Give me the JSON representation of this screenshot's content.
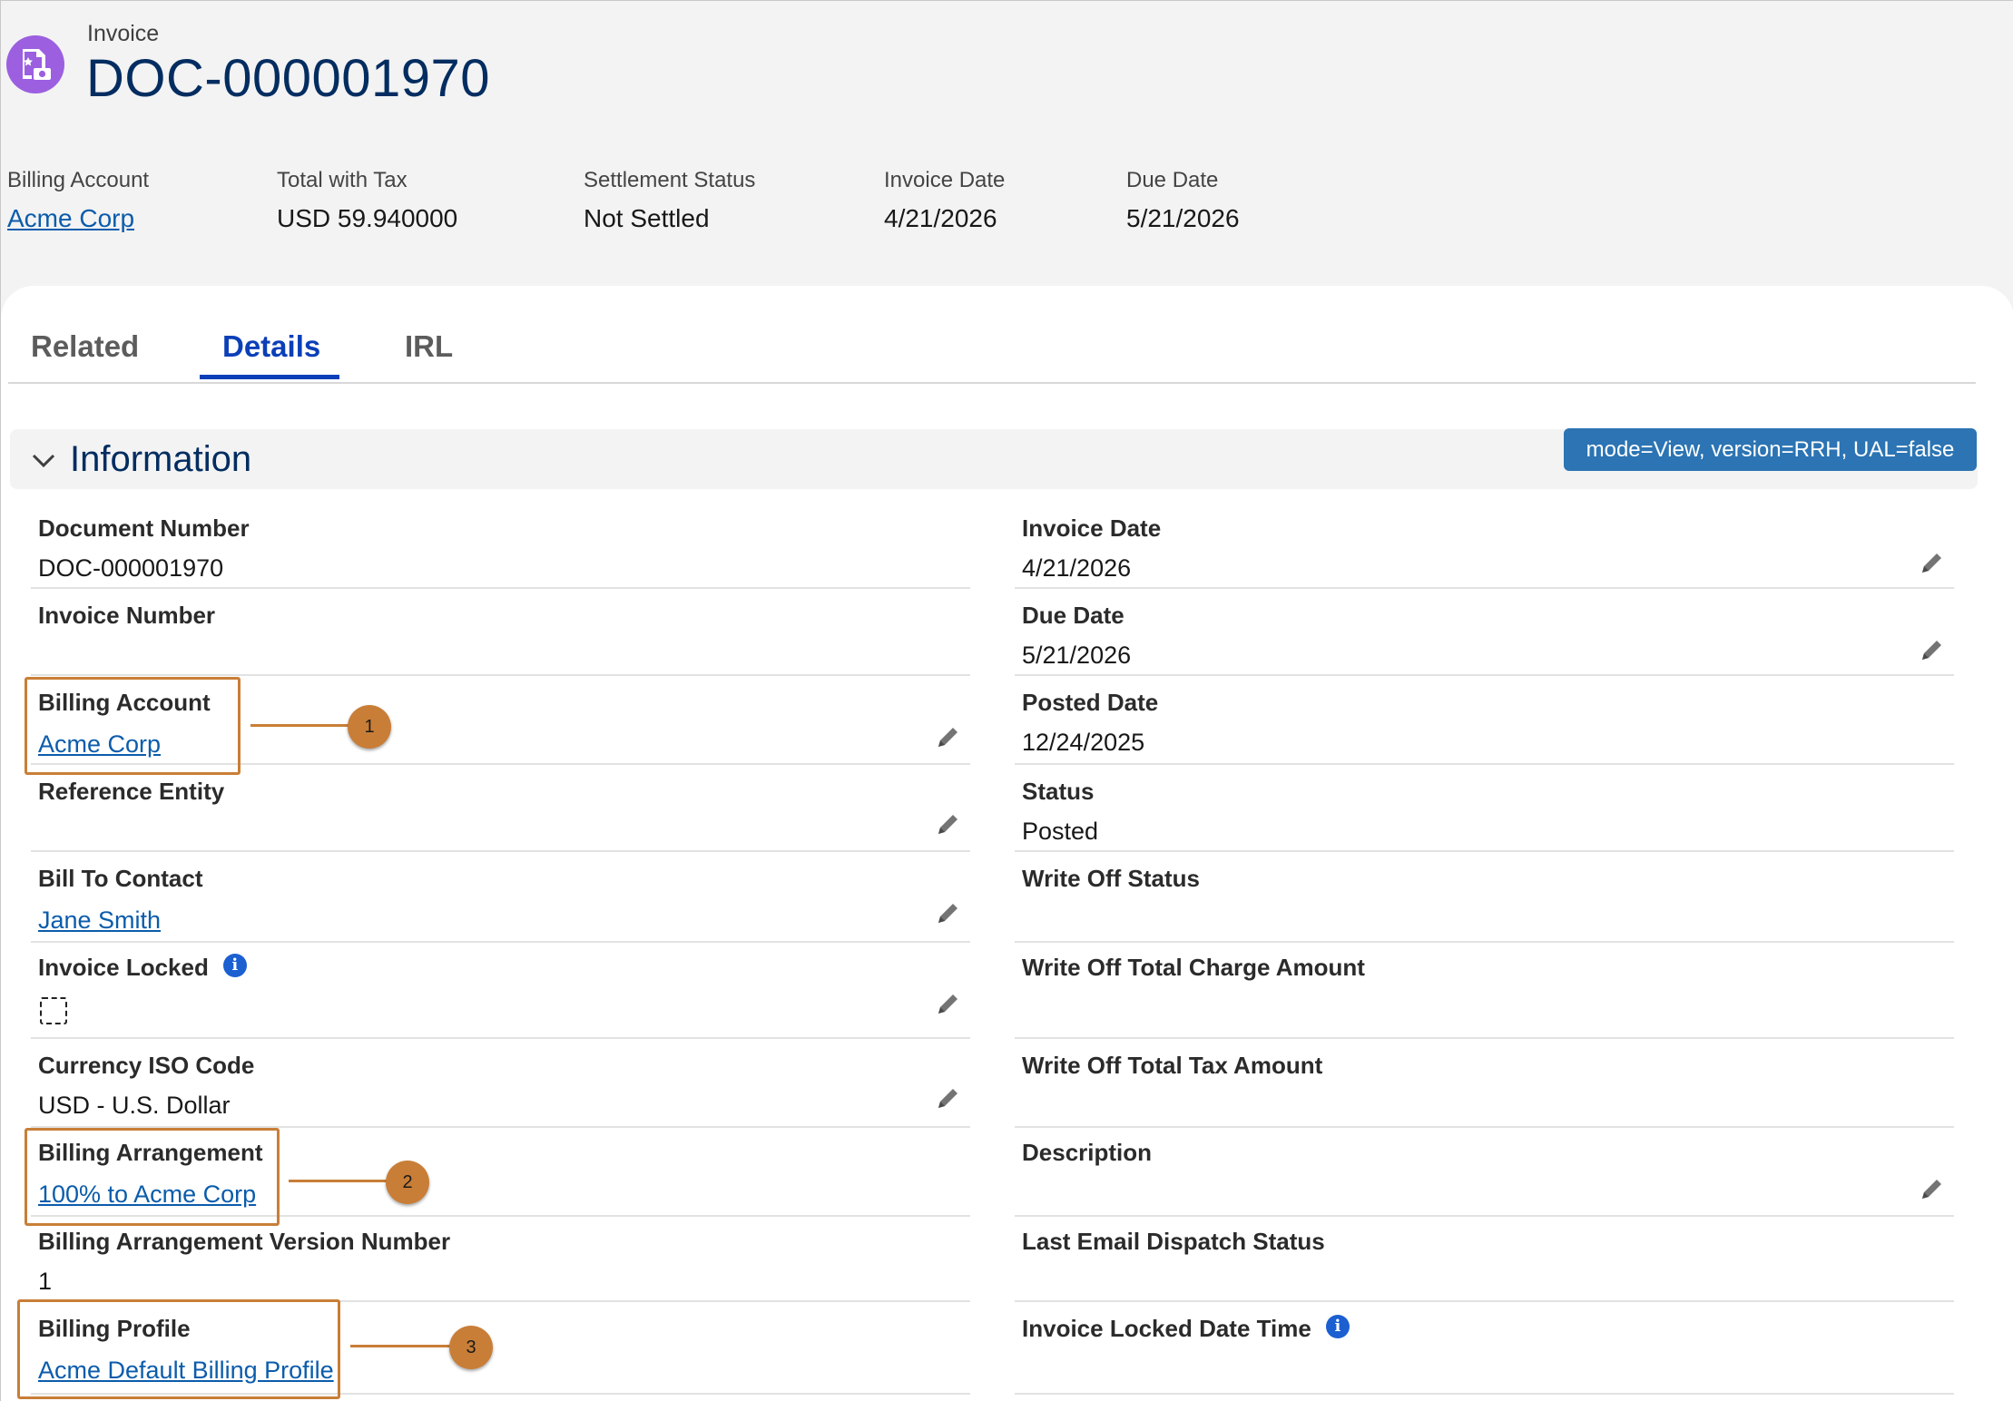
{
  "header": {
    "object_label": "Invoice",
    "record_title": "DOC-000001970",
    "icon": "invoice-icon"
  },
  "highlights": [
    {
      "label": "Billing Account",
      "value": "Acme Corp",
      "is_link": true
    },
    {
      "label": "Total with Tax",
      "value": "USD 59.940000",
      "is_link": false
    },
    {
      "label": "Settlement Status",
      "value": "Not Settled",
      "is_link": false
    },
    {
      "label": "Invoice Date",
      "value": "4/21/2026",
      "is_link": false
    },
    {
      "label": "Due Date",
      "value": "5/21/2026",
      "is_link": false
    }
  ],
  "tabs": [
    {
      "label": "Related",
      "active": false
    },
    {
      "label": "Details",
      "active": true
    },
    {
      "label": "IRL",
      "active": false
    }
  ],
  "section": {
    "title": "Information",
    "badge": "mode=View, version=RRH, UAL=false"
  },
  "fields_left": [
    {
      "label": "Document Number",
      "value": "DOC-000001970",
      "editable": false
    },
    {
      "label": "Invoice Number",
      "value": "",
      "editable": false
    },
    {
      "label": "Billing Account",
      "value": "Acme Corp",
      "is_link": true,
      "editable": true
    },
    {
      "label": "Reference Entity",
      "value": "",
      "editable": true
    },
    {
      "label": "Bill To Contact",
      "value": "Jane Smith",
      "is_link": true,
      "editable": true
    },
    {
      "label": "Invoice Locked",
      "value": "",
      "checkbox": true,
      "info": true,
      "editable": true
    },
    {
      "label": "Currency ISO Code",
      "value": "USD - U.S. Dollar",
      "editable": true
    },
    {
      "label": "Billing Arrangement",
      "value": "100% to Acme Corp",
      "is_link": true,
      "editable": false
    },
    {
      "label": "Billing Arrangement Version Number",
      "value": "1",
      "editable": false
    },
    {
      "label": "Billing Profile",
      "value": "Acme Default Billing Profile",
      "is_link": true,
      "editable": false
    }
  ],
  "fields_right": [
    {
      "label": "Invoice Date",
      "value": "4/21/2026",
      "editable": true
    },
    {
      "label": "Due Date",
      "value": "5/21/2026",
      "editable": true
    },
    {
      "label": "Posted Date",
      "value": "12/24/2025",
      "editable": false
    },
    {
      "label": "Status",
      "value": "Posted",
      "editable": false
    },
    {
      "label": "Write Off Status",
      "value": "",
      "editable": false
    },
    {
      "label": "Write Off Total Charge Amount",
      "value": "",
      "editable": false
    },
    {
      "label": "Write Off Total Tax Amount",
      "value": "",
      "editable": false
    },
    {
      "label": "Description",
      "value": "",
      "editable": true
    },
    {
      "label": "Last Email Dispatch Status",
      "value": "",
      "editable": false
    },
    {
      "label": "Invoice Locked Date Time",
      "value": "",
      "info": true,
      "editable": false
    }
  ],
  "callouts": [
    "1",
    "2",
    "3"
  ],
  "colors": {
    "accent": "#0b3fb8",
    "link": "#0b5cab",
    "title": "#032d60",
    "callout": "#c97e37",
    "badge": "#2c74b3",
    "icon_bg": "#9b5fe0"
  }
}
